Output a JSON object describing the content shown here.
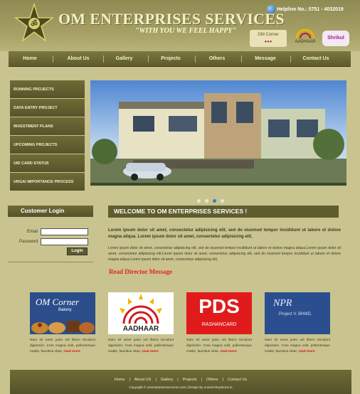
{
  "header": {
    "brand": "OM ENTERPRISES SERVICES",
    "tagline": "\"WITH YOU WE FEEL HAPPY\"",
    "helpline": "Helpline No.: 0751 - 4032019",
    "logos": [
      "OM Corner",
      "AADHAAR",
      "Shrikul"
    ]
  },
  "nav": [
    "Home",
    "About Us",
    "Gallery",
    "Projects",
    "Others",
    "Message",
    "Contact Us"
  ],
  "sidebar": [
    "RUNNING PROJECTS",
    "DATA ENTRY PROJECT",
    "INVESTMENT PLANS",
    "UPCOMING PROJECTS",
    "UID CARD STATUS",
    "URGAI IMPORTANCE PROCESS"
  ],
  "login": {
    "title": "Customer Login",
    "email_label": "Email",
    "password_label": "Password",
    "button": "Login"
  },
  "welcome": {
    "title": "WELCOME TO OM ENTERPRISES SERVICES !",
    "para1": "Lorem ipsum dolor sit amet, consectetur adipisicing elit, sed do eiusmod tempor incididunt ut labore et dolore magna aliqua. Lorem ipsum dolor sit amet, consectetur adipisicing elit,",
    "para2": "Lorem ipsum dolor sit amet, consectetur adipisicing elit, sed do eiusmod tempor incididunt ut labore et dolore magna aliqua.Lorem ipsum dolor sit amet, consectetur adipisicing elit.Lorem ipsum dolor sit amet, consectetur adipisicing elit, sed do eiusmod tempor incididunt ut labore et dolore magna aliqua.Lorem ipsum dolor sit amet, consectetur adipisicing elit,",
    "director_link": "Read Director Message"
  },
  "cards": [
    {
      "title": "OM Corner",
      "sub": "Bakery",
      "text": "Nam sit amet justo vel libero tincidunt dignissim. Cras magna velit, pellentesque mattis, faucibus vitae,",
      "more": "read more"
    },
    {
      "title": "AADHAAR",
      "sub": "",
      "text": "Nam sit amet justo vel libero tincidunt dignissim. Cras magna velit, pellentesque mattis, faucibus vitae,",
      "more": "read more"
    },
    {
      "title": "PDS",
      "sub": "RASHANCARD",
      "text": "Nam sit amet justo vel libero tincidunt dignissim. Cras magna velit, pellentesque mattis, faucibus vitae,",
      "more": "read more"
    },
    {
      "title": "NPR",
      "sub": "Project V. BHMD.",
      "text": "Nam sit amet justo vel libero tincidunt dignissim. Cras magna velit, pellentesque mattis, faucibus vitae,",
      "more": "read more"
    }
  ],
  "footer": {
    "links": [
      "Home",
      "About US",
      "Gallery",
      "Projects",
      "Others",
      "Contact Us"
    ],
    "copyright": "Copyright © omenterprisesservices.com  |  Design By numerichsystems.in"
  },
  "colors": {
    "accent": "#5f5c2e",
    "background": "#c9c38f",
    "link_red": "#e0271b"
  }
}
